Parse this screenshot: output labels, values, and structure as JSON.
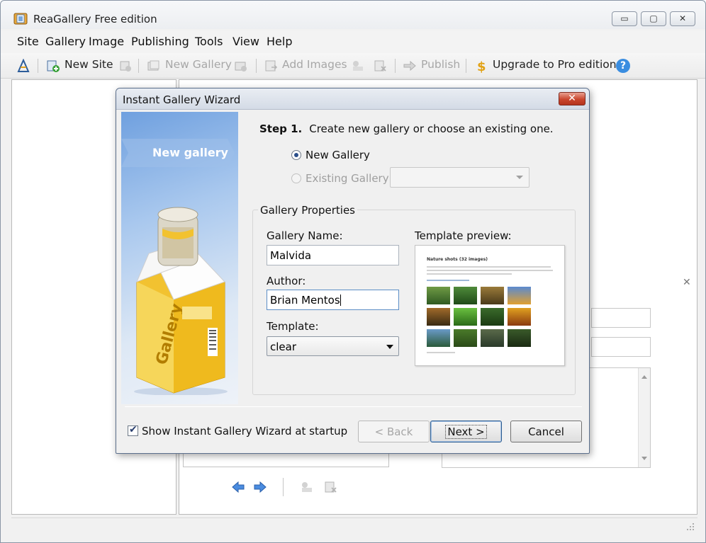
{
  "app": {
    "title": "ReaGallery Free edition",
    "window_controls": {
      "minimize": "▭",
      "restore": "▢",
      "close": "✕"
    }
  },
  "menu": [
    "Site",
    "Gallery",
    "Image",
    "Publishing",
    "Tools",
    "View",
    "Help"
  ],
  "toolbar": {
    "new_site": "New Site",
    "new_gallery": "New Gallery",
    "add_images": "Add Images",
    "publish": "Publish",
    "upgrade": "Upgrade to Pro edition",
    "help_icon": "?"
  },
  "background_close": "✕",
  "dialog": {
    "title": "Instant Gallery Wizard",
    "close": "✕",
    "banner_label": "New gallery",
    "step_label": "Step 1.",
    "step_text": "Create new gallery or choose an existing one.",
    "new_gallery_option": "New Gallery",
    "existing_gallery_option": "Existing Gallery",
    "existing_gallery_value": "",
    "group_label": "Gallery Properties",
    "gallery_name_label": "Gallery Name:",
    "gallery_name_value": "Malvida",
    "author_label": "Author:",
    "author_value": "Brian Mentos",
    "template_label": "Template:",
    "template_value": "clear",
    "preview_label": "Template preview:",
    "preview_title": "Nature shots (32 images)",
    "startup_checkbox_label": "Show Instant Gallery Wizard at startup",
    "startup_checked": true,
    "back_button": "< Back",
    "next_button": "Next >",
    "cancel_button": "Cancel"
  },
  "colors": {
    "accent": "#2b5b8f",
    "close_red": "#c9462e",
    "banner_blue": "#6fa0df",
    "box_yellow": "#f2c230",
    "help_blue": "#3a8de0"
  }
}
